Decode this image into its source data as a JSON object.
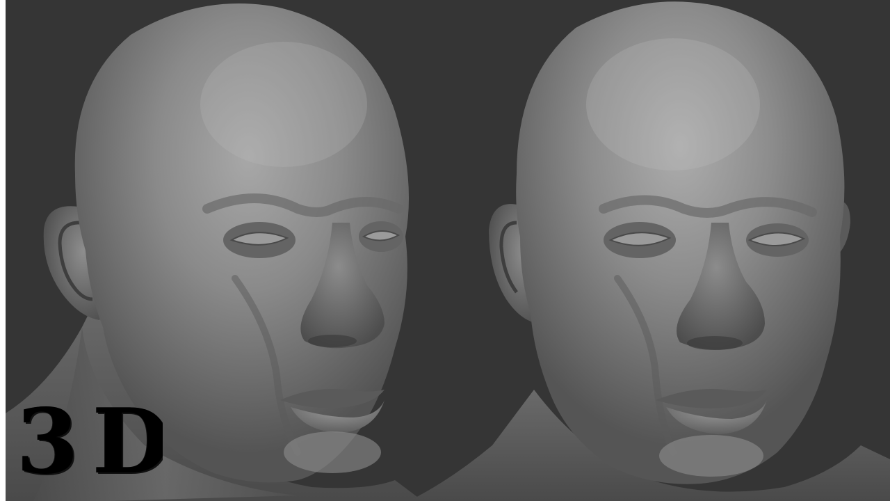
{
  "scene": {
    "background_color": "#353535",
    "left_border_color": "#ffffff",
    "sculpt_color": "#8a8a8a",
    "views": [
      {
        "name": "three-quarter-left"
      },
      {
        "name": "three-quarter-right"
      }
    ]
  },
  "overlay": {
    "badge_text": "3D",
    "badge_color": "#000000"
  }
}
